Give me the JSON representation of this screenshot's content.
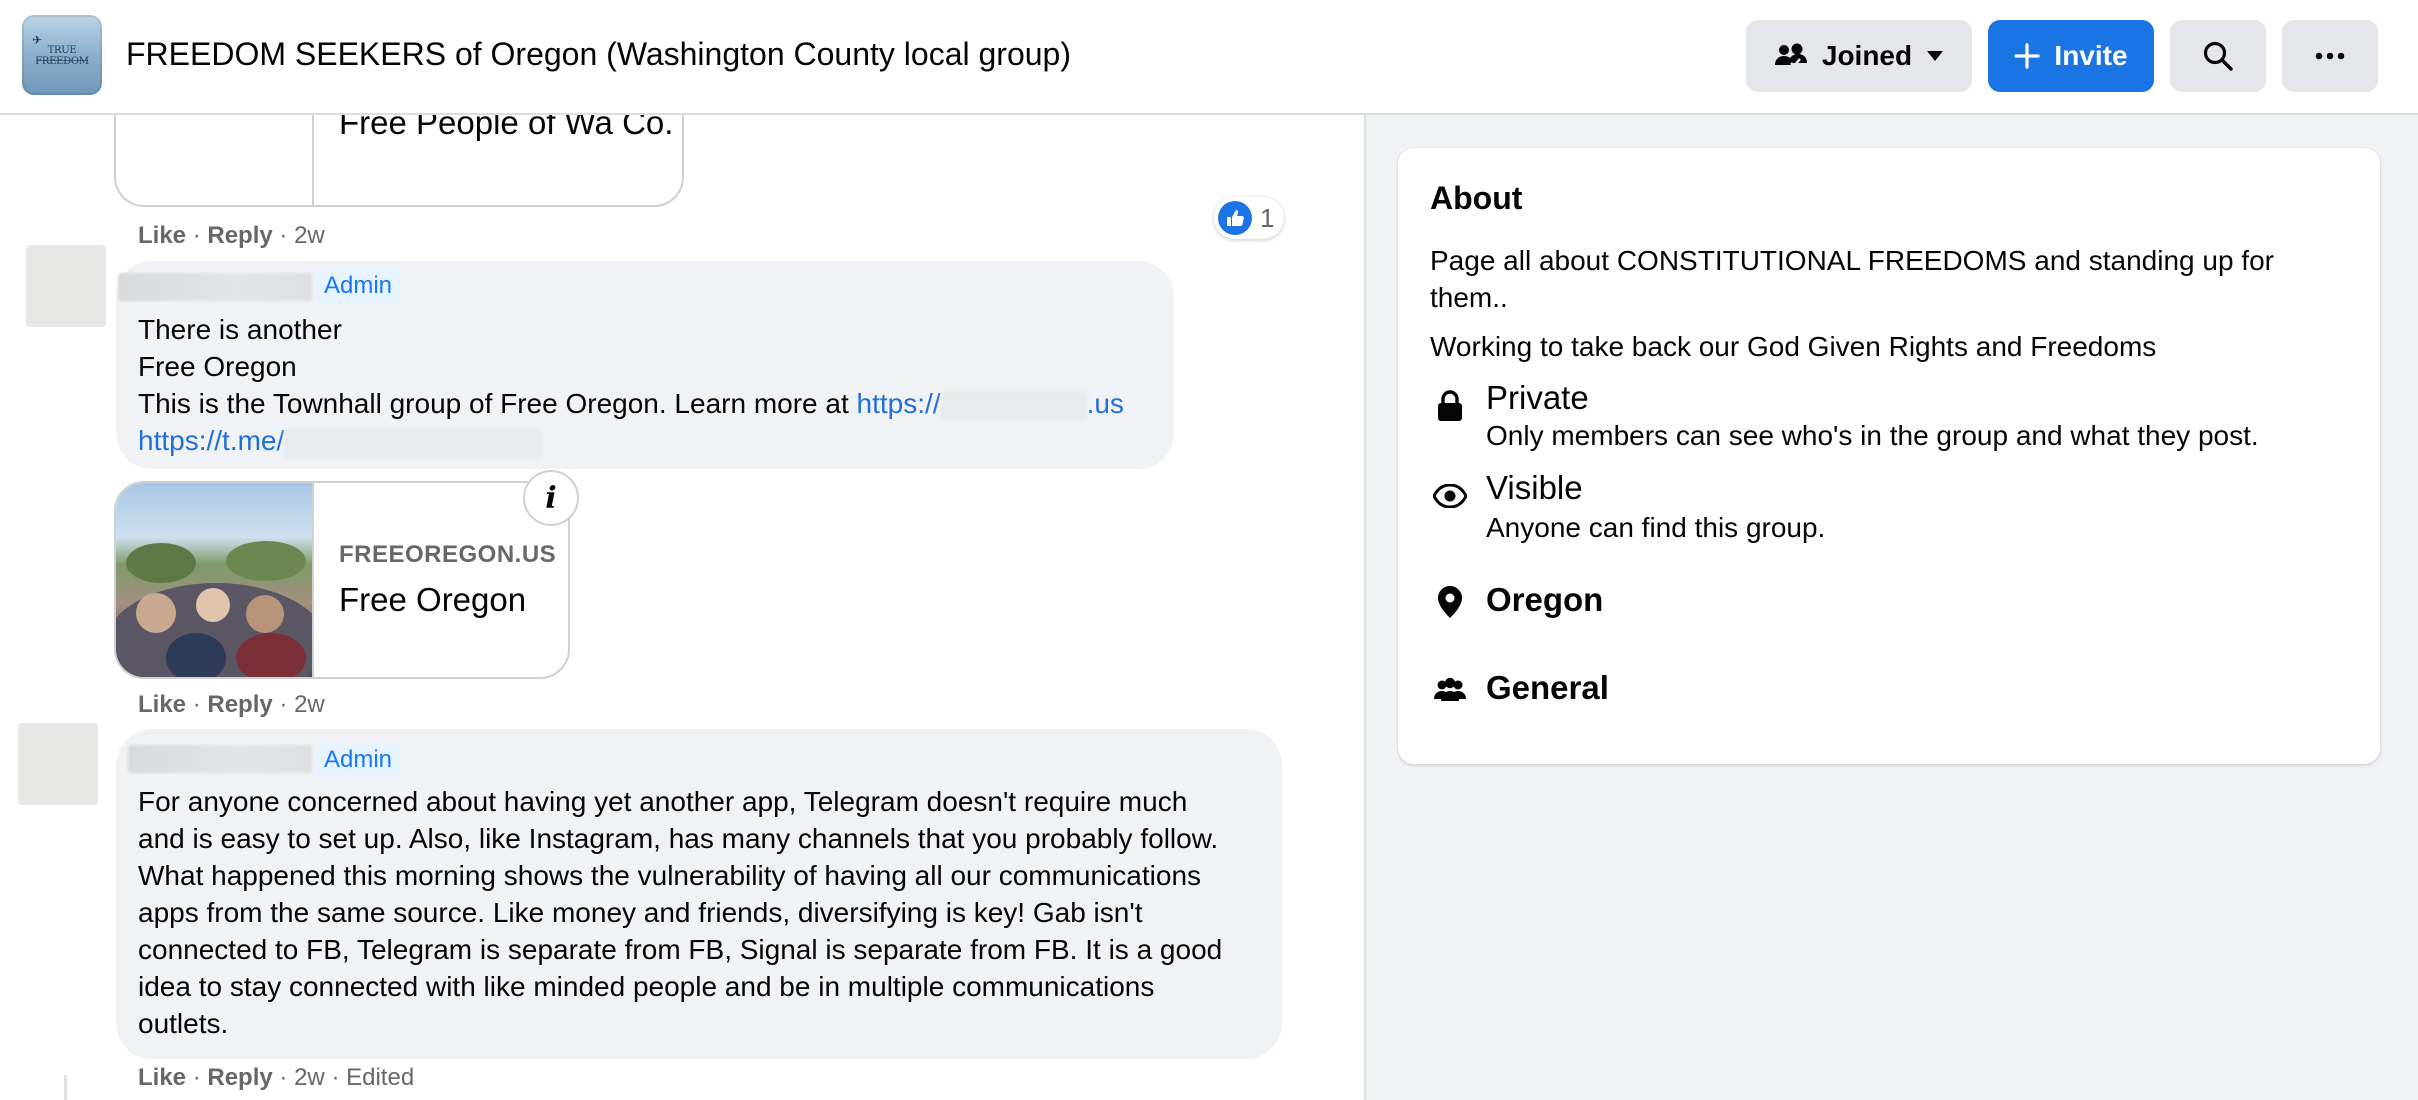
{
  "header": {
    "group_name": "FREEDOM SEEKERS of Oregon (Washington County local group)",
    "joined_label": "Joined",
    "invite_label": "Invite",
    "thumb_text": "TRUE FREEDOM"
  },
  "feed": {
    "top_card": {
      "title": "Free People of Wa Co."
    },
    "top_actions": {
      "like": "Like",
      "reply": "Reply",
      "time": "2w"
    },
    "reaction_count": "1",
    "comment1": {
      "badge": "Admin",
      "line1": "There is another",
      "line2": "Free Oregon",
      "line3_text": "This is the Townhall group of Free Oregon. Learn more at ",
      "line3_link_start": "https://",
      "line3_link_end": ".us",
      "line4_link": "https://t.me/",
      "card_domain": "FREEOREGON.US",
      "card_title": "Free Oregon",
      "info_glyph": "i",
      "actions": {
        "like": "Like",
        "reply": "Reply",
        "time": "2w"
      }
    },
    "comment2": {
      "badge": "Admin",
      "lines": [
        "For anyone concerned about having yet another app, Telegram doesn't require much",
        "and is easy to set up. Also, like Instagram, has many channels that you probably follow.",
        "What happened this morning shows the vulnerability of having all our communications",
        "apps from the same source. Like money and friends, diversifying is key! Gab isn't",
        "connected to FB, Telegram is separate from FB, Signal is separate from FB. It is a good",
        "idea to stay connected with like minded people and be in multiple communications",
        "outlets."
      ],
      "actions": {
        "like": "Like",
        "reply": "Reply",
        "time": "2w",
        "edited": "Edited"
      }
    }
  },
  "about": {
    "heading": "About",
    "desc1": "Page all about CONSTITUTIONAL FREEDOMS and standing up for them..",
    "desc2": "Working to take back our God Given Rights and Freedoms",
    "private_title": "Private",
    "private_sub": "Only members can see who's in the group and what they post.",
    "visible_title": "Visible",
    "visible_sub": "Anyone can find this group.",
    "location": "Oregon",
    "category": "General"
  },
  "colors": {
    "accent": "#1b74e4",
    "admin_badge_bg": "#e7f3ff",
    "link": "#216fdb"
  },
  "icons": [
    "group-members-icon",
    "caret-down-icon",
    "plus-icon",
    "search-icon",
    "more-icon",
    "lock-icon",
    "eye-icon",
    "location-pin-icon",
    "people-icon",
    "thumbs-up-icon"
  ]
}
